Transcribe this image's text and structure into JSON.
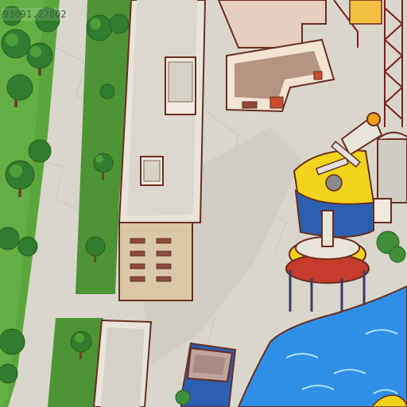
{
  "hud": {
    "coordinate_readout": "93091.27802"
  },
  "palette": {
    "grass": "#5aa63c",
    "grass_dark": "#3f7f2b",
    "pavement": "#d9d6cc",
    "pavement_shadow": "#c4c1b8",
    "building_roof": "#e9e4da",
    "building_wall": "#d9c7a8",
    "outline": "#6a2e20",
    "water": "#2f8fe6",
    "water_light": "#7cc3ff",
    "ride_yellow": "#f2d21b",
    "ride_blue": "#2b5fb2",
    "ride_red": "#c63b2b"
  }
}
